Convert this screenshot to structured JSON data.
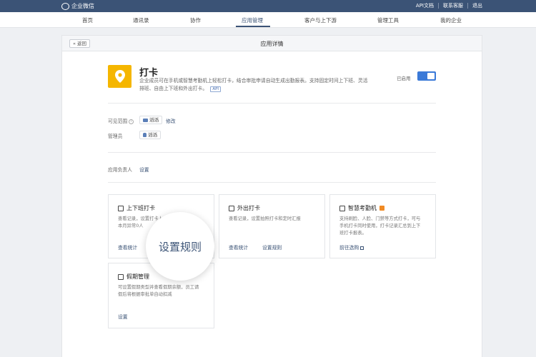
{
  "topbar": {
    "brand": "企业微信",
    "links": [
      "API文档",
      "联系客服",
      "退出"
    ]
  },
  "nav": {
    "items": [
      "首页",
      "通讯录",
      "协作",
      "应用管理",
      "客户与上下游",
      "管理工具",
      "我的企业"
    ],
    "active_index": 3
  },
  "panel": {
    "back_label": "« 返回",
    "title": "应用详情"
  },
  "app": {
    "name": "打卡",
    "desc_line1": "企业成员可在手机或智慧考勤机上轻松打卡，结合审批申请自动生成出勤报表。支持固定时间上下班、灵活",
    "desc_line2": "排班、自由上下班和外出打卡。",
    "api_badge": "API",
    "status_label": "已启用",
    "enabled": true
  },
  "visibility": {
    "label": "可见范围",
    "chip": "滔滔",
    "edit_link": "修改"
  },
  "admins": {
    "label": "管理员",
    "chip": "滔滔"
  },
  "owner": {
    "label": "应用负责人",
    "link": "设置"
  },
  "cards": [
    {
      "title": "上下班打卡",
      "desc_line1": "查看记录，设置打卡人员",
      "desc_line2": "本月异常0人",
      "links": [
        "查看统计"
      ]
    },
    {
      "title": "外出打卡",
      "desc_line1": "查看记录，设置拍照打卡和定时汇报",
      "desc_line2": "",
      "links": [
        "查看统计",
        "设置规则"
      ]
    },
    {
      "title": "智慧考勤机",
      "desc_line1": "支持刷脸、人脸、门禁等方式打卡，可与",
      "desc_line2": "手机打卡同时使用，打卡记录汇总到上下",
      "desc_line3": "班打卡报表。",
      "links": [
        "前往选购"
      ]
    },
    {
      "title": "假期管理",
      "desc_line1": "可设置假期类型并查看假期余额，员工请",
      "desc_line2": "假后将根据审批单自动扣减",
      "links": [
        "设置"
      ]
    }
  ],
  "magnifier": {
    "label": "设置规则"
  },
  "colors": {
    "topbar": "#3b5376",
    "accent": "#3b5376",
    "app_icon": "#f5b600",
    "toggle": "#3b7ad8",
    "new_badge": "#f08a24"
  }
}
